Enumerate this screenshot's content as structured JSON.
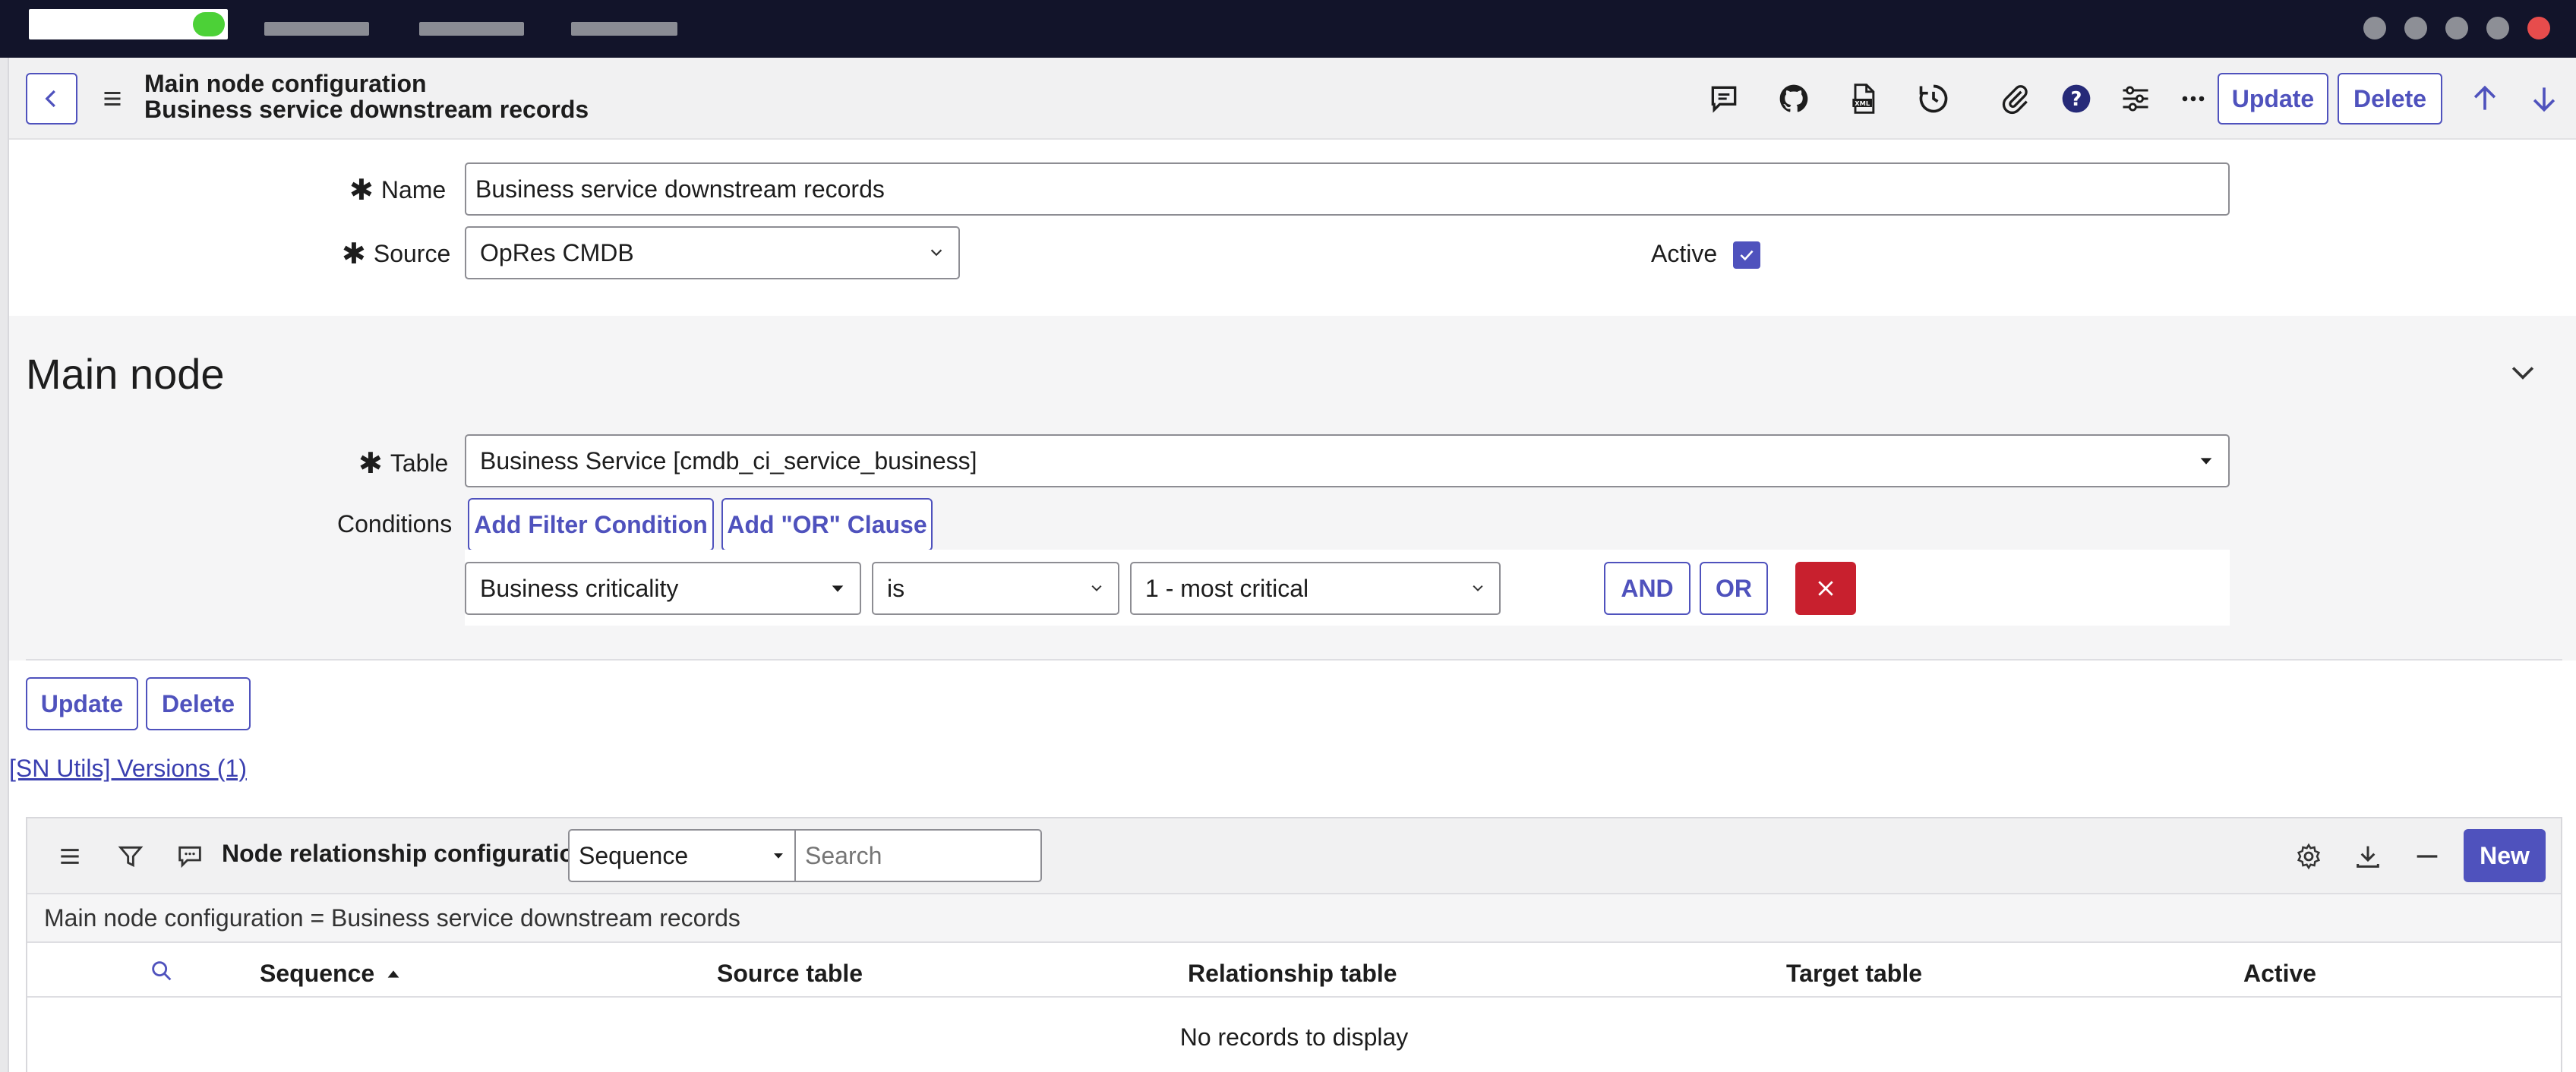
{
  "form": {
    "title": "Main node configuration",
    "subtitle": "Business service downstream records",
    "update_label": "Update",
    "delete_label": "Delete",
    "fields": {
      "name_label": "Name",
      "name_value": "Business service downstream records",
      "source_label": "Source",
      "source_value": "OpRes CMDB",
      "active_label": "Active",
      "active_checked": true
    }
  },
  "main_node": {
    "heading": "Main node",
    "table_label": "Table",
    "table_value": "Business Service [cmdb_ci_service_business]",
    "conditions_label": "Conditions",
    "add_filter_label": "Add Filter Condition",
    "add_or_label": "Add \"OR\" Clause",
    "condition": {
      "field": "Business criticality",
      "operator": "is",
      "value": "1 - most critical"
    },
    "and_label": "AND",
    "or_label": "OR"
  },
  "bottom_buttons": {
    "update_label": "Update",
    "delete_label": "Delete"
  },
  "versions_link": "[SN Utils] Versions (1)",
  "related_list": {
    "title": "Node relationship configurations",
    "search_field": "Sequence",
    "search_placeholder": "Search",
    "new_label": "New",
    "breadcrumb": "Main node configuration = Business service downstream records",
    "columns": [
      "Sequence",
      "Source table",
      "Relationship table",
      "Target table",
      "Active"
    ],
    "empty_text": "No records to display"
  },
  "colors": {
    "accent": "#4f52bd",
    "topbar": "#12142a",
    "danger": "#c8202e",
    "green_status": "#4cd137",
    "close_red": "#e74c4c"
  }
}
